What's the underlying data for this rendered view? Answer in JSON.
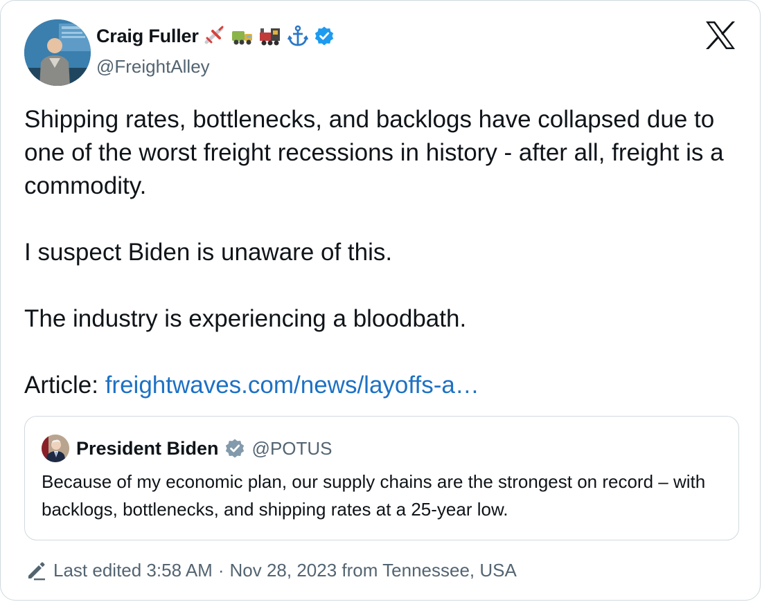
{
  "tweet": {
    "author": {
      "display_name": "Craig Fuller",
      "handle": "@FreightAlley",
      "name_emojis": [
        "airplane-emoji",
        "truck-emoji",
        "locomotive-emoji",
        "anchor-emoji"
      ],
      "verified_icon": "verified-badge-icon"
    },
    "platform_icon": "x-logo-icon",
    "body": {
      "paragraph_1": "Shipping rates, bottlenecks, and backlogs have collapsed due to one of the worst freight recessions in history - after all, freight is a commodity.",
      "paragraph_2": "I suspect Biden is unaware of this.",
      "paragraph_3": "The industry is experiencing a bloodbath.",
      "article_label": "Article:",
      "article_link": "freightwaves.com/news/layoffs-a…"
    },
    "quoted_tweet": {
      "display_name": "President Biden",
      "handle": "@POTUS",
      "verified_icon": "government-verified-badge-icon",
      "text": "Because of my economic plan, our supply chains are the strongest on record – with backlogs, bottlenecks, and shipping rates at a 25-year low."
    },
    "footer": {
      "edit_icon": "pencil-icon",
      "edited_label": "Last edited 3:58 AM",
      "separator": "·",
      "date_location": "Nov 28, 2023 from Tennessee, USA"
    }
  },
  "colors": {
    "text_primary": "#0f1419",
    "text_secondary": "#536471",
    "link": "#1d71c4",
    "verified_blue": "#1d9bf0",
    "verified_gray": "#829aab",
    "border": "#cfd9de"
  }
}
